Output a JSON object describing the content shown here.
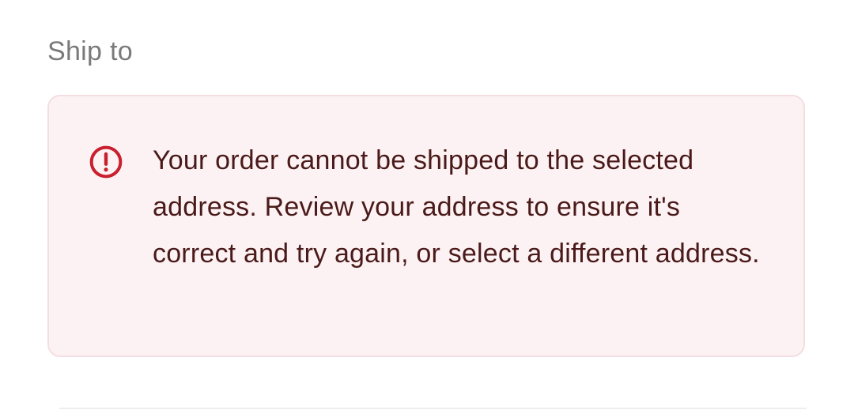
{
  "shipping": {
    "section_title": "Ship to",
    "alert": {
      "icon": "alert-circle-icon",
      "message": "Your order cannot be shipped to the selected address. Review your address to ensure it's correct and try again, or select a different address."
    }
  },
  "colors": {
    "alert_background": "#fdf2f3",
    "alert_border": "#f3dfe1",
    "alert_icon": "#c8202e",
    "alert_text": "#4a1a1a",
    "section_title": "#7a7a7a"
  }
}
